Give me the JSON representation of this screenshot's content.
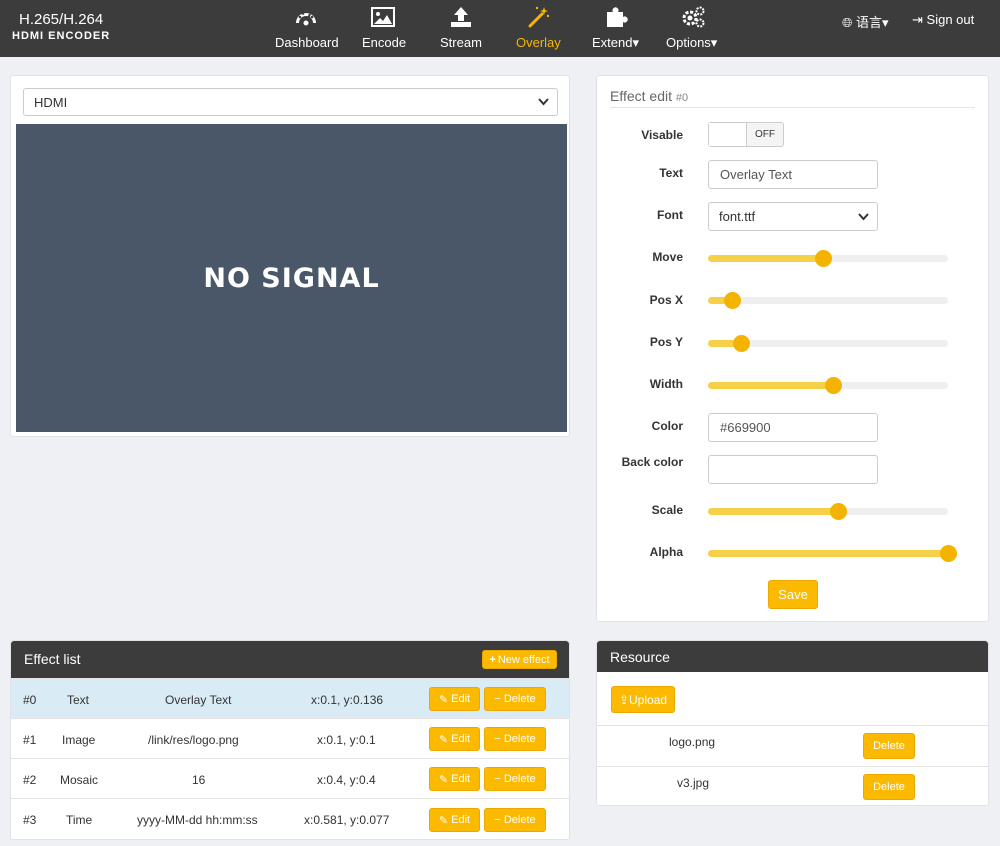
{
  "brand": {
    "line1": "H.265/H.264",
    "line2": "HDMI ENCODER"
  },
  "nav": [
    {
      "label": "Dashboard",
      "icon": "dashboard-icon"
    },
    {
      "label": "Encode",
      "icon": "image-icon"
    },
    {
      "label": "Stream",
      "icon": "upload-icon"
    },
    {
      "label": "Overlay",
      "icon": "magic-wand-icon",
      "active": true
    },
    {
      "label": "Extend▾",
      "icon": "puzzle-icon"
    },
    {
      "label": "Options▾",
      "icon": "gears-icon"
    }
  ],
  "topright": {
    "language": "语言▾",
    "signout": "Sign out"
  },
  "colors": {
    "accent": "#f7b500",
    "header": "#3c3c3c",
    "preview": "#4a5768"
  },
  "preview": {
    "source": "HDMI",
    "message": "NO SIGNAL"
  },
  "effect_edit": {
    "title": "Effect edit",
    "index": "#0",
    "labels": {
      "visable": "Visable",
      "text": "Text",
      "font": "Font",
      "move": "Move",
      "posx": "Pos X",
      "posy": "Pos Y",
      "width": "Width",
      "color": "Color",
      "backcolor": "Back color",
      "scale": "Scale",
      "alpha": "Alpha"
    },
    "visable_state": "OFF",
    "text_value": "Overlay Text",
    "font_value": "font.ttf",
    "color_value": "#669900",
    "backcolor_value": "",
    "sliders": {
      "move": 0.48,
      "posx": 0.1,
      "posy": 0.136,
      "width": 0.52,
      "scale": 0.54,
      "alpha": 1.0
    },
    "save": "Save"
  },
  "effect_list": {
    "title": "Effect list",
    "new_button": "New effect",
    "edit_label": "Edit",
    "delete_label": "Delete",
    "rows": [
      {
        "id": "#0",
        "type": "Text",
        "content": "Overlay Text",
        "pos": "x:0.1, y:0.136"
      },
      {
        "id": "#1",
        "type": "Image",
        "content": "/link/res/logo.png",
        "pos": "x:0.1, y:0.1"
      },
      {
        "id": "#2",
        "type": "Mosaic",
        "content": "16",
        "pos": "x:0.4, y:0.4"
      },
      {
        "id": "#3",
        "type": "Time",
        "content": "yyyy-MM-dd hh:mm:ss",
        "pos": "x:0.581, y:0.077"
      }
    ]
  },
  "resource": {
    "title": "Resource",
    "upload": "Upload",
    "delete_label": "Delete",
    "files": [
      "logo.png",
      "v3.jpg"
    ]
  }
}
